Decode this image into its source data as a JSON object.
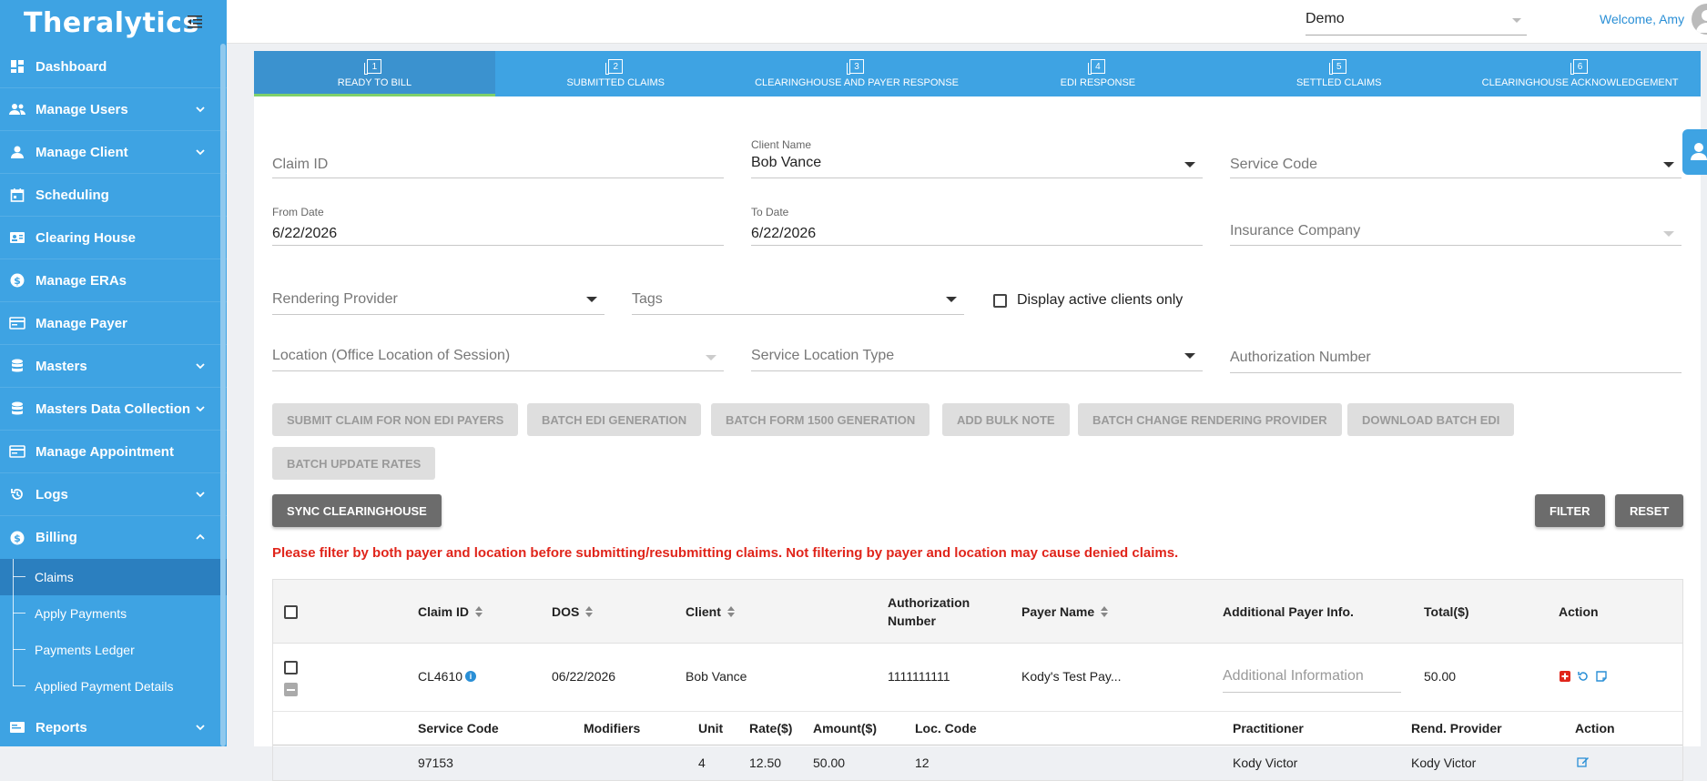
{
  "app": {
    "logo": "Theralytics"
  },
  "topbar": {
    "org_select": "Demo",
    "welcome": "Welcome, Amy"
  },
  "sidebar": {
    "items": [
      {
        "label": "Dashboard",
        "icon": "dashboard-icon",
        "has_chevron": false
      },
      {
        "label": "Manage Users",
        "icon": "users-icon",
        "has_chevron": true
      },
      {
        "label": "Manage Client",
        "icon": "person-icon",
        "has_chevron": true
      },
      {
        "label": "Scheduling",
        "icon": "calendar-icon",
        "has_chevron": false
      },
      {
        "label": "Clearing House",
        "icon": "id-card-icon",
        "has_chevron": false
      },
      {
        "label": "Manage ERAs",
        "icon": "dollar-circle-icon",
        "has_chevron": false
      },
      {
        "label": "Manage Payer",
        "icon": "card-icon",
        "has_chevron": false
      },
      {
        "label": "Masters",
        "icon": "database-icon",
        "has_chevron": true
      },
      {
        "label": "Masters Data Collection",
        "icon": "database-icon",
        "has_chevron": true
      },
      {
        "label": "Manage Appointment",
        "icon": "card-icon",
        "has_chevron": false
      },
      {
        "label": "Logs",
        "icon": "history-icon",
        "has_chevron": true
      },
      {
        "label": "Billing",
        "icon": "dollar-circle-icon",
        "has_chevron": true
      }
    ],
    "billing_sub": [
      {
        "label": "Claims"
      },
      {
        "label": "Apply Payments"
      },
      {
        "label": "Payments Ledger"
      },
      {
        "label": "Applied Payment Details"
      }
    ],
    "reports": {
      "label": "Reports",
      "icon": "reports-icon"
    }
  },
  "tabs": [
    {
      "num": "1",
      "label": "READY TO BILL"
    },
    {
      "num": "2",
      "label": "SUBMITTED CLAIMS"
    },
    {
      "num": "3",
      "label": "CLEARINGHOUSE AND PAYER RESPONSE"
    },
    {
      "num": "4",
      "label": "EDI RESPONSE"
    },
    {
      "num": "5",
      "label": "SETTLED CLAIMS"
    },
    {
      "num": "6",
      "label": "CLEARINGHOUSE ACKNOWLEDGEMENT"
    }
  ],
  "filters": {
    "claim_id": {
      "placeholder": "Claim ID"
    },
    "client_name": {
      "label": "Client Name",
      "value": "Bob Vance"
    },
    "service_code": {
      "placeholder": "Service Code"
    },
    "from_date": {
      "label": "From Date",
      "value": "6/22/2026"
    },
    "to_date": {
      "label": "To Date",
      "value": "6/22/2026"
    },
    "insurance_company": {
      "placeholder": "Insurance Company"
    },
    "rendering_provider": {
      "placeholder": "Rendering Provider"
    },
    "tags": {
      "placeholder": "Tags"
    },
    "active_clients": {
      "label": "Display active clients only"
    },
    "location": {
      "placeholder": "Location (Office Location of Session)"
    },
    "service_location_type": {
      "placeholder": "Service Location Type"
    },
    "authorization_number": {
      "placeholder": "Authorization Number"
    }
  },
  "actions": {
    "submit_non_edi": "SUBMIT CLAIM FOR NON EDI PAYERS",
    "batch_edi": "BATCH EDI GENERATION",
    "batch_1500": "BATCH FORM 1500 GENERATION",
    "bulk_note": "ADD BULK NOTE",
    "batch_rendering": "BATCH CHANGE RENDERING PROVIDER",
    "download_edi": "DOWNLOAD BATCH EDI",
    "batch_rates": "BATCH UPDATE RATES",
    "sync": "SYNC CLEARINGHOUSE",
    "filter": "FILTER",
    "reset": "RESET"
  },
  "warning": "Please filter by both payer and location before submitting/resubmitting claims. Not filtering by payer and location may cause denied claims.",
  "table": {
    "headers": {
      "claim_id": "Claim ID",
      "dos": "DOS",
      "client": "Client",
      "auth_1": "Authorization",
      "auth_2": "Number",
      "payer": "Payer Name",
      "additional": "Additional Payer Info.",
      "total": "Total($)",
      "action": "Action"
    },
    "row": {
      "claim_id": "CL4610",
      "dos": "06/22/2026",
      "client": "Bob Vance",
      "auth": "1111111111",
      "payer": "Kody's Test Pay...",
      "additional_placeholder": "Additional Information",
      "total": "50.00"
    },
    "sub_headers": {
      "service_code": "Service Code",
      "modifiers": "Modifiers",
      "unit": "Unit",
      "rate": "Rate($)",
      "amount": "Amount($)",
      "loc_code": "Loc. Code",
      "practitioner": "Practitioner",
      "rend_provider": "Rend. Provider",
      "action": "Action"
    },
    "sub_row": {
      "service_code": "97153",
      "unit": "4",
      "rate": "12.50",
      "amount": "50.00",
      "loc_code": "12",
      "practitioner": "Kody Victor",
      "rend_provider": "Kody Victor"
    }
  },
  "colors": {
    "primary": "#3ea3e3",
    "active_tab": "#3b92cf",
    "warning": "#e0251b",
    "active_indicator": "#7fd06a"
  }
}
